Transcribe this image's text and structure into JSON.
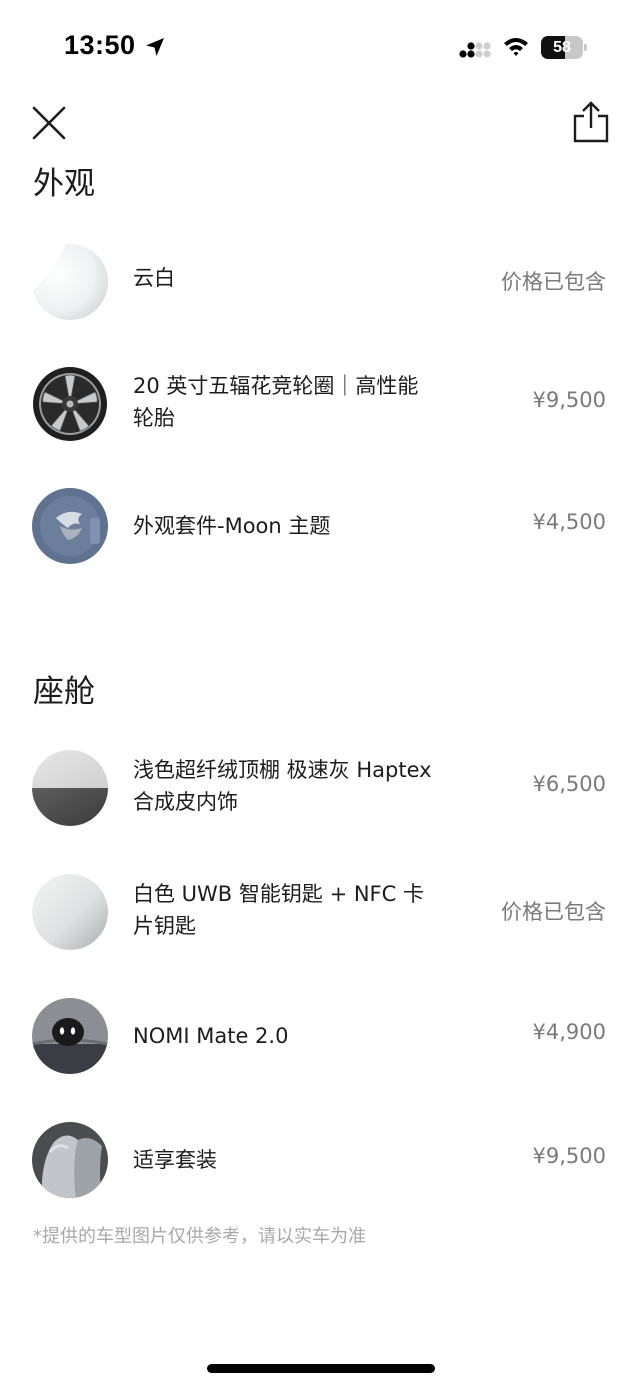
{
  "status_bar": {
    "time": "13:50",
    "battery": "58",
    "battery_level": 0.58,
    "icons": [
      "location-arrow-icon",
      "signal-icon",
      "wifi-icon",
      "battery-icon"
    ]
  },
  "nav": {
    "close_icon": "close-icon",
    "share_icon": "share-icon"
  },
  "exterior": {
    "title": "外观",
    "items": [
      {
        "name": "云白",
        "price": "价格已包含",
        "thumb": "cloud-white-swatch"
      },
      {
        "name": "20 英寸五辐花竞轮圈｜高性能轮胎",
        "price": "¥9,500",
        "thumb": "wheel-icon"
      },
      {
        "name": "外观套件-Moon 主题",
        "price": "¥4,500",
        "thumb": "moon-theme-icon"
      }
    ]
  },
  "cabin": {
    "title": "座舱",
    "items": [
      {
        "name": "浅色超纤绒顶棚 极速灰 Haptex合成皮内饰",
        "price": "¥6,500",
        "thumb": "interior-swatch"
      },
      {
        "name": "白色 UWB 智能钥匙 + NFC 卡片钥匙",
        "price": "价格已包含",
        "thumb": "key-swatch"
      },
      {
        "name": "NOMI Mate 2.0",
        "price": "¥4,900",
        "thumb": "nomi-icon"
      },
      {
        "name": "适享套装",
        "price": "¥9,500",
        "thumb": "seat-icon"
      }
    ]
  },
  "disclaimer": "*提供的车型图片仅供参考，请以实车为准",
  "colors": {
    "text": "#1c1c1c",
    "price": "#7a7a7a",
    "disclaimer": "#a8a8a8",
    "background": "#ffffff"
  }
}
